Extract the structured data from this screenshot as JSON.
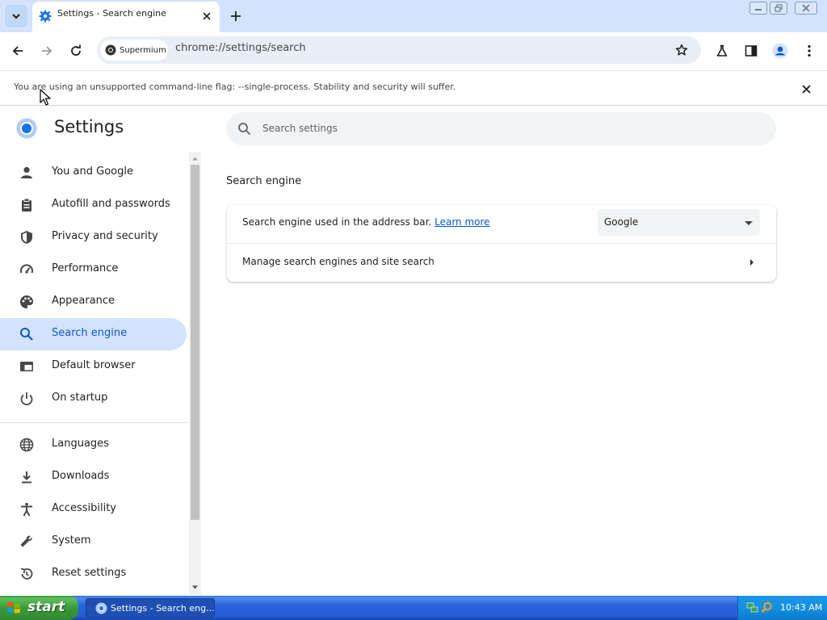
{
  "tab": {
    "title": "Settings - Search engine",
    "close": "×"
  },
  "toolbar": {
    "site_chip": "Supermium",
    "url": "chrome://settings/search"
  },
  "infobar": {
    "text": "You are using an unsupported command-line flag: --single-process. Stability and security will suffer."
  },
  "settings": {
    "title": "Settings",
    "search_placeholder": "Search settings",
    "nav": [
      {
        "label": "You and Google",
        "icon": "person-icon"
      },
      {
        "label": "Autofill and passwords",
        "icon": "clipboard-icon"
      },
      {
        "label": "Privacy and security",
        "icon": "shield-icon"
      },
      {
        "label": "Performance",
        "icon": "speedometer-icon"
      },
      {
        "label": "Appearance",
        "icon": "palette-icon"
      },
      {
        "label": "Search engine",
        "icon": "search-icon",
        "active": true
      },
      {
        "label": "Default browser",
        "icon": "browser-window-icon"
      },
      {
        "label": "On startup",
        "icon": "power-icon"
      },
      {
        "label": "Languages",
        "icon": "globe-icon"
      },
      {
        "label": "Downloads",
        "icon": "download-icon"
      },
      {
        "label": "Accessibility",
        "icon": "accessibility-icon"
      },
      {
        "label": "System",
        "icon": "wrench-icon"
      },
      {
        "label": "Reset settings",
        "icon": "reset-icon"
      }
    ],
    "section_title": "Search engine",
    "row1_label": "Search engine used in the address bar.",
    "learn_more": "Learn more",
    "engine_value": "Google",
    "row2_label": "Manage search engines and site search"
  },
  "taskbar": {
    "start": "start",
    "task": "Settings - Search eng...",
    "clock": "10:43 AM"
  },
  "colors": {
    "accent": "#0b57d0",
    "active_nav": "#d3e3fd",
    "tabstrip": "#d3e3fd"
  }
}
